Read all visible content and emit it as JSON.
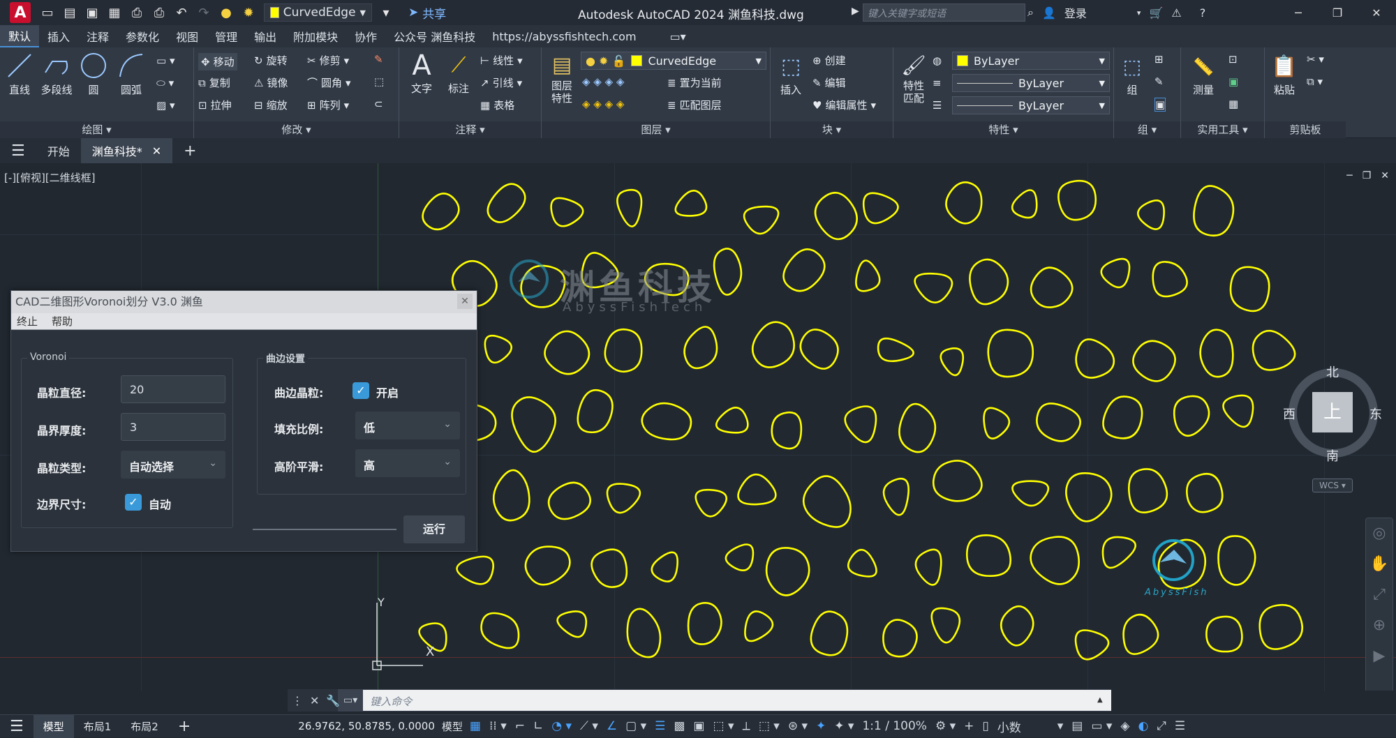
{
  "titlebar": {
    "app_logo": "A",
    "layer_name": "CurvedEdge",
    "share_label": "共享",
    "window_title": "Autodesk AutoCAD 2024    渊鱼科技.dwg",
    "search_placeholder": "键入关键字或短语",
    "login_label": "登录"
  },
  "menu": [
    "默认",
    "插入",
    "注释",
    "参数化",
    "视图",
    "管理",
    "输出",
    "附加模块",
    "协作",
    "公众号 渊鱼科技",
    "https://abyssfishtech.com"
  ],
  "ribbon": {
    "draw": {
      "title": "绘图",
      "line": "直线",
      "polyline": "多段线",
      "circle": "圆",
      "arc": "圆弧"
    },
    "modify": {
      "title": "修改",
      "move": "移动",
      "rotate": "旋转",
      "trim": "修剪",
      "copy": "复制",
      "mirror": "镜像",
      "fillet": "圆角",
      "stretch": "拉伸",
      "scale": "缩放",
      "array": "阵列"
    },
    "annotation": {
      "title": "注释",
      "text": "文字",
      "dimension": "标注",
      "linear": "线性",
      "leader": "引线",
      "table": "表格"
    },
    "layers": {
      "title": "图层",
      "layer_props": "图层\n特性",
      "current_layer": "CurvedEdge",
      "set_current": "置为当前",
      "match_layer": "匹配图层"
    },
    "block": {
      "title": "块",
      "insert": "插入",
      "create": "创建",
      "edit": "编辑",
      "edit_attr": "编辑属性"
    },
    "properties": {
      "title": "特性",
      "match": "特性\n匹配",
      "color": "ByLayer",
      "linetype": "ByLayer",
      "lineweight": "ByLayer"
    },
    "group": {
      "title": "组",
      "group": "组"
    },
    "utilities": {
      "title": "实用工具",
      "measure": "测量"
    },
    "clipboard": {
      "title": "剪贴板",
      "paste": "粘贴"
    }
  },
  "doctabs": {
    "start": "开始",
    "active": "渊鱼科技*"
  },
  "viewport": {
    "label": "[-][俯视][二维线框]",
    "compass": {
      "north": "北",
      "south": "南",
      "east": "东",
      "west": "西",
      "top": "上",
      "wcs": "WCS"
    },
    "ucs_x": "X",
    "ucs_y": "Y",
    "watermark_cn": "渊鱼科技",
    "watermark_en": "AbyssFishTech",
    "logo_text": "AbyssFish",
    "curve_color": "#ffff00"
  },
  "dialog": {
    "title": "CAD二维图形Voronoi划分 V3.0 渊鱼",
    "menu_stop": "终止",
    "menu_help": "帮助",
    "group_voronoi": "Voronoi",
    "grain_diameter_label": "晶粒直径:",
    "grain_diameter": "20",
    "boundary_thickness_label": "晶界厚度:",
    "boundary_thickness": "3",
    "grain_type_label": "晶粒类型:",
    "grain_type": "自动选择",
    "boundary_size_label": "边界尺寸:",
    "boundary_size": "自动",
    "group_curve": "曲边设置",
    "curved_grain_label": "曲边晶粒:",
    "curved_grain": "开启",
    "fill_ratio_label": "填充比例:",
    "fill_ratio": "低",
    "smooth_label": "高阶平滑:",
    "smooth": "高",
    "run_label": "运行"
  },
  "cmdline": {
    "placeholder": "键入命令"
  },
  "statusbar": {
    "model_tab": "模型",
    "layout1": "布局1",
    "layout2": "布局2",
    "coords": "26.9762, 50.8785, 0.0000",
    "model_mode": "模型",
    "scale": "1:1 / 100%",
    "units": "小数"
  }
}
